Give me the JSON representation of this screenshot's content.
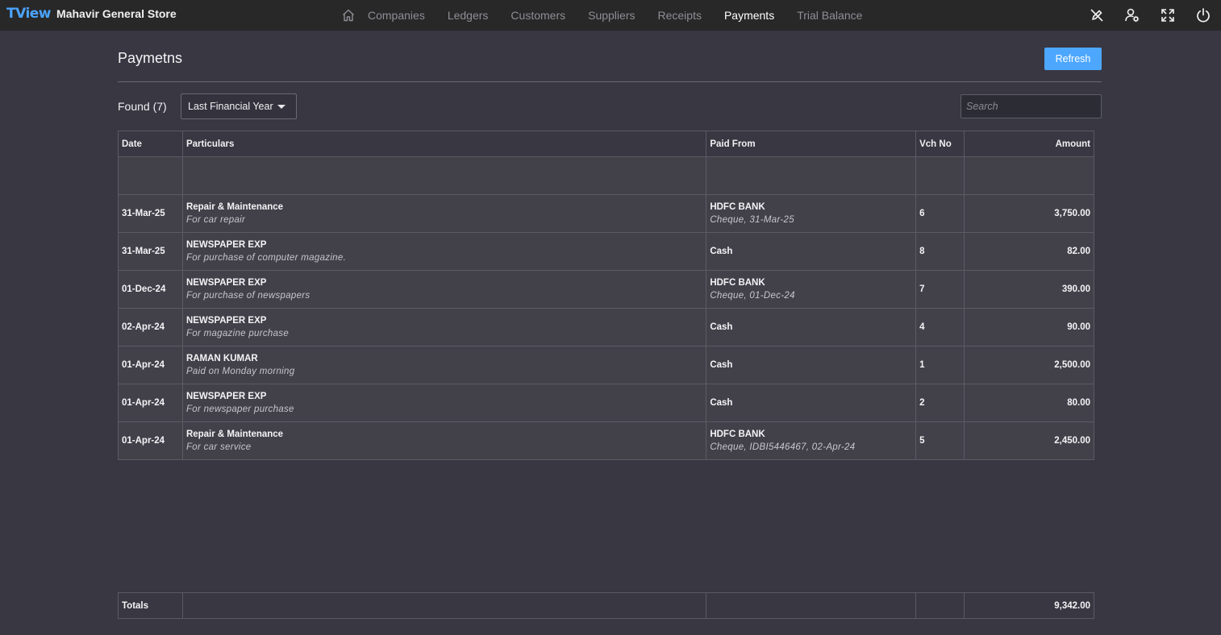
{
  "app": {
    "logo": "TView",
    "company": "Mahavir General Store"
  },
  "nav": {
    "home_icon": "home-icon",
    "items": [
      {
        "label": "Companies"
      },
      {
        "label": "Ledgers"
      },
      {
        "label": "Customers"
      },
      {
        "label": "Suppliers"
      },
      {
        "label": "Receipts"
      },
      {
        "label": "Payments",
        "active": true
      },
      {
        "label": "Trial Balance"
      }
    ]
  },
  "top_icons": [
    "no-pen-icon",
    "user-settings-icon",
    "fullscreen-icon",
    "power-icon"
  ],
  "page": {
    "title": "Paymetns",
    "refresh_label": "Refresh",
    "found_label": "Found (7)",
    "period": "Last Financial Year",
    "search_placeholder": "Search"
  },
  "table": {
    "headers": {
      "date": "Date",
      "particulars": "Particulars",
      "paid_from": "Paid From",
      "vch_no": "Vch No",
      "amount": "Amount"
    },
    "rows": [
      {
        "date": "31-Mar-25",
        "particulars": "Repair & Maintenance",
        "narration": "For car repair",
        "paid_from": "HDFC BANK",
        "paid_from_detail": "Cheque, 31-Mar-25",
        "vch_no": "6",
        "amount": "3,750.00"
      },
      {
        "date": "31-Mar-25",
        "particulars": "NEWSPAPER EXP",
        "narration": "For purchase of computer magazine.",
        "paid_from": "Cash",
        "paid_from_detail": "",
        "vch_no": "8",
        "amount": "82.00"
      },
      {
        "date": "01-Dec-24",
        "particulars": "NEWSPAPER EXP",
        "narration": "For purchase of newspapers",
        "paid_from": "HDFC BANK",
        "paid_from_detail": "Cheque, 01-Dec-24",
        "vch_no": "7",
        "amount": "390.00"
      },
      {
        "date": "02-Apr-24",
        "particulars": "NEWSPAPER EXP",
        "narration": "For magazine purchase",
        "paid_from": "Cash",
        "paid_from_detail": "",
        "vch_no": "4",
        "amount": "90.00"
      },
      {
        "date": "01-Apr-24",
        "particulars": "RAMAN KUMAR",
        "narration": "Paid on Monday morning",
        "paid_from": "Cash",
        "paid_from_detail": "",
        "vch_no": "1",
        "amount": "2,500.00"
      },
      {
        "date": "01-Apr-24",
        "particulars": "NEWSPAPER EXP",
        "narration": "For newspaper purchase",
        "paid_from": "Cash",
        "paid_from_detail": "",
        "vch_no": "2",
        "amount": "80.00"
      },
      {
        "date": "01-Apr-24",
        "particulars": "Repair & Maintenance",
        "narration": "For car service",
        "paid_from": "HDFC BANK",
        "paid_from_detail": "Cheque, IDBI5446467, 02-Apr-24",
        "vch_no": "5",
        "amount": "2,450.00"
      }
    ],
    "totals_label": "Totals",
    "totals_amount": "9,342.00"
  },
  "colors": {
    "accent": "#4da7ff",
    "brand": "#4aa3ff",
    "background": "#383742",
    "topbar": "#282828"
  }
}
